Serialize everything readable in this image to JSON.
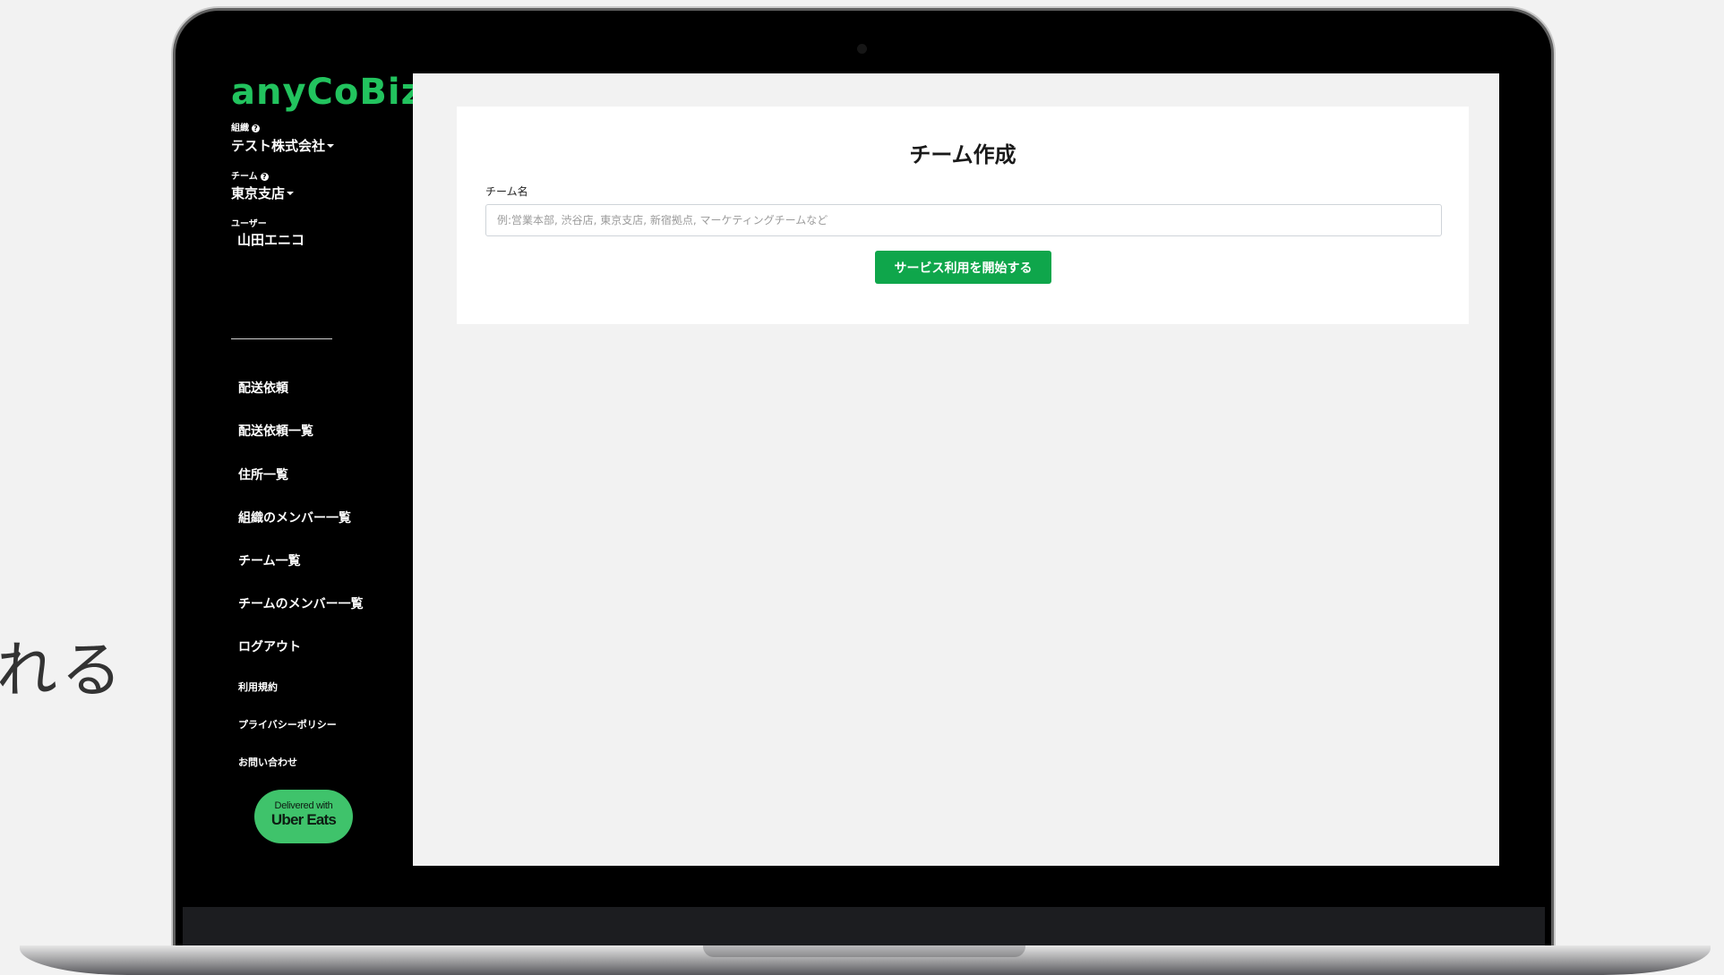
{
  "background_text": "れる",
  "sidebar": {
    "logo": "anyCoBiz",
    "org_label": "組織",
    "org_value": "テスト株式会社",
    "team_label": "チーム",
    "team_value": "東京支店",
    "user_label": "ユーザー",
    "user_value": "山田エニコ",
    "help_glyph": "?",
    "nav": [
      {
        "label": "配送依頼"
      },
      {
        "label": "配送依頼一覧"
      },
      {
        "label": "住所一覧"
      },
      {
        "label": "組織のメンバー一覧"
      },
      {
        "label": "チーム一覧"
      },
      {
        "label": "チームのメンバー一覧"
      },
      {
        "label": "ログアウト"
      }
    ],
    "footer_links": [
      {
        "label": "利用規約"
      },
      {
        "label": "プライバシーポリシー"
      },
      {
        "label": "お問い合わせ"
      }
    ],
    "badge": {
      "line1": "Delivered with",
      "line2": "Uber Eats"
    }
  },
  "main": {
    "title": "チーム作成",
    "field_label": "チーム名",
    "field_value": "",
    "field_placeholder": "例:営業本部, 渋谷店, 東京支店, 新宿拠点, マーケティングチームなど",
    "submit_label": "サービス利用を開始する"
  },
  "colors": {
    "brand_green": "#22c35e",
    "button_green": "#0fa64b",
    "badge_green": "#3fc36b",
    "sidebar_bg": "#000000",
    "content_bg": "#f2f2f2"
  }
}
